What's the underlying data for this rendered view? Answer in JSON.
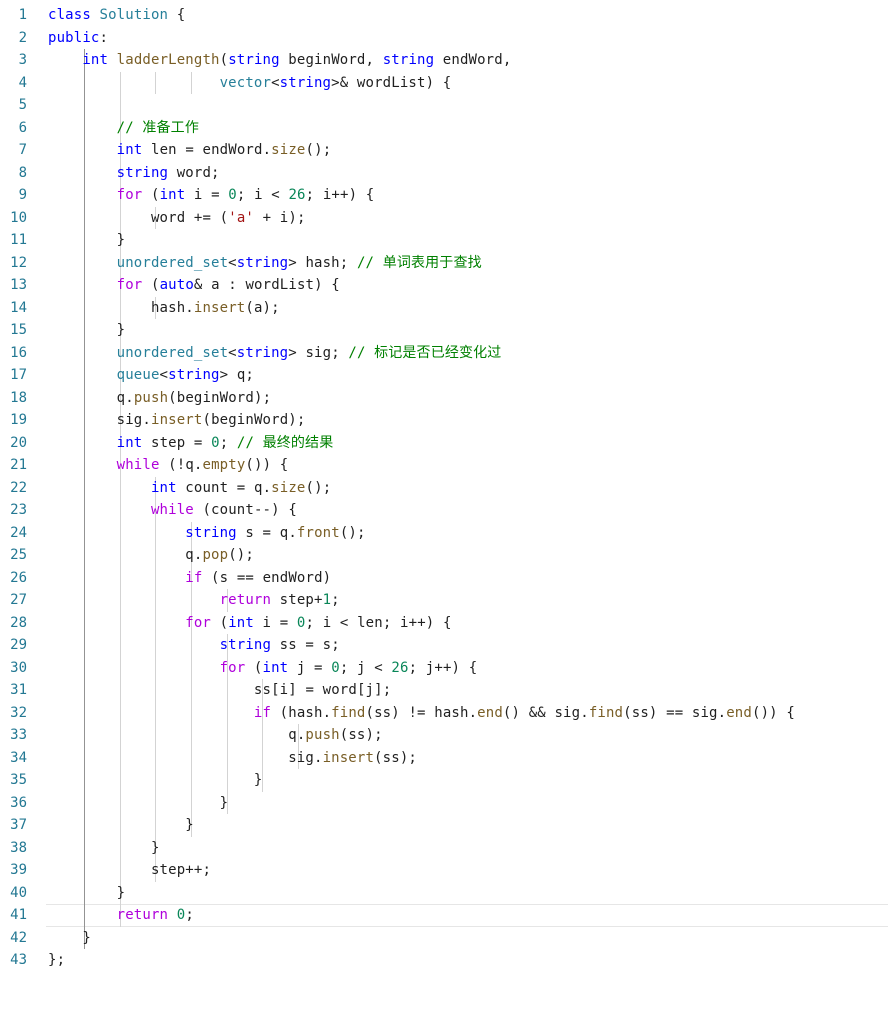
{
  "editor": {
    "language": "cpp",
    "current_line": 41,
    "colors": {
      "keyword": "#0000ff",
      "control": "#af00db",
      "type": "#267f99",
      "function": "#795e26",
      "number": "#098658",
      "string": "#a31515",
      "comment": "#008000",
      "line_number": "#237893",
      "text": "#1f1f1f"
    },
    "lines": [
      {
        "n": "1",
        "text": "class Solution {"
      },
      {
        "n": "2",
        "text": "public:"
      },
      {
        "n": "3",
        "text": "    int ladderLength(string beginWord, string endWord,"
      },
      {
        "n": "4",
        "text": "                    vector<string>& wordList) {"
      },
      {
        "n": "5",
        "text": ""
      },
      {
        "n": "6",
        "text": "        // 准备工作"
      },
      {
        "n": "7",
        "text": "        int len = endWord.size();"
      },
      {
        "n": "8",
        "text": "        string word;"
      },
      {
        "n": "9",
        "text": "        for (int i = 0; i < 26; i++) {"
      },
      {
        "n": "10",
        "text": "            word += ('a' + i);"
      },
      {
        "n": "11",
        "text": "        }"
      },
      {
        "n": "12",
        "text": "        unordered_set<string> hash; // 单词表用于查找"
      },
      {
        "n": "13",
        "text": "        for (auto& a : wordList) {"
      },
      {
        "n": "14",
        "text": "            hash.insert(a);"
      },
      {
        "n": "15",
        "text": "        }"
      },
      {
        "n": "16",
        "text": "        unordered_set<string> sig; // 标记是否已经变化过"
      },
      {
        "n": "17",
        "text": "        queue<string> q;"
      },
      {
        "n": "18",
        "text": "        q.push(beginWord);"
      },
      {
        "n": "19",
        "text": "        sig.insert(beginWord);"
      },
      {
        "n": "20",
        "text": "        int step = 0; // 最终的结果"
      },
      {
        "n": "21",
        "text": "        while (!q.empty()) {"
      },
      {
        "n": "22",
        "text": "            int count = q.size();"
      },
      {
        "n": "23",
        "text": "            while (count--) {"
      },
      {
        "n": "24",
        "text": "                string s = q.front();"
      },
      {
        "n": "25",
        "text": "                q.pop();"
      },
      {
        "n": "26",
        "text": "                if (s == endWord)"
      },
      {
        "n": "27",
        "text": "                    return step+1;"
      },
      {
        "n": "28",
        "text": "                for (int i = 0; i < len; i++) {"
      },
      {
        "n": "29",
        "text": "                    string ss = s;"
      },
      {
        "n": "30",
        "text": "                    for (int j = 0; j < 26; j++) {"
      },
      {
        "n": "31",
        "text": "                        ss[i] = word[j];"
      },
      {
        "n": "32",
        "text": "                        if (hash.find(ss) != hash.end() && sig.find(ss) == sig.end()) {"
      },
      {
        "n": "33",
        "text": "                            q.push(ss);"
      },
      {
        "n": "34",
        "text": "                            sig.insert(ss);"
      },
      {
        "n": "35",
        "text": "                        }"
      },
      {
        "n": "36",
        "text": "                    }"
      },
      {
        "n": "37",
        "text": "                }"
      },
      {
        "n": "38",
        "text": "            }"
      },
      {
        "n": "39",
        "text": "            step++;"
      },
      {
        "n": "40",
        "text": "        }"
      },
      {
        "n": "41",
        "text": "        return 0;"
      },
      {
        "n": "42",
        "text": "    }"
      },
      {
        "n": "43",
        "text": "};"
      }
    ]
  }
}
